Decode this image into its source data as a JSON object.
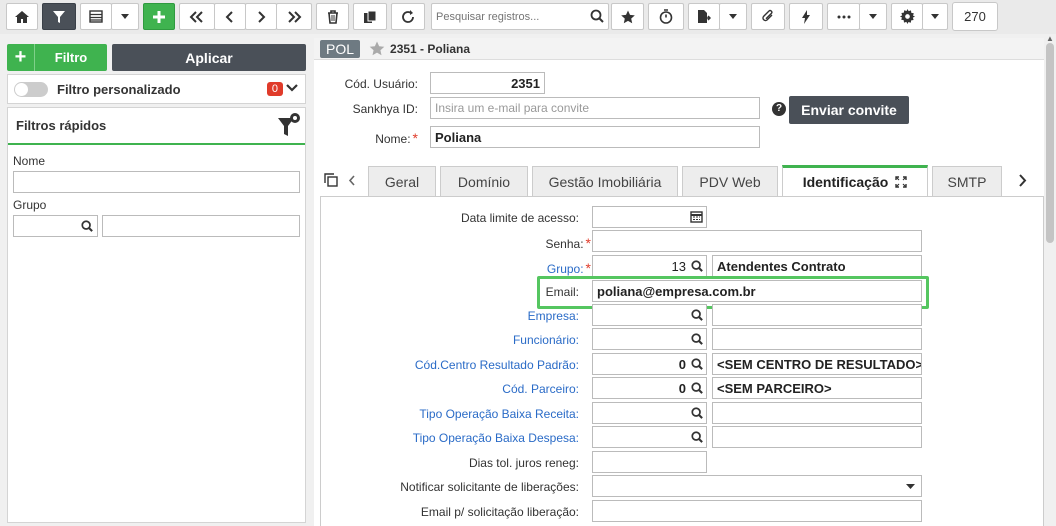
{
  "toolbar": {
    "search_placeholder": "Pesquisar registros...",
    "record_count": "270",
    "icons": [
      "home-icon",
      "filter-icon",
      "grid-icon",
      "chevron-down-icon",
      "plus-icon",
      "first-icon",
      "prev-icon",
      "next-icon",
      "last-icon",
      "trash-icon",
      "copy-icon",
      "refresh-icon",
      "search-icon",
      "star-icon",
      "timer-icon",
      "export-icon",
      "chevron-down-icon",
      "attach-icon",
      "lightning-icon",
      "more-icon",
      "chevron-down-icon",
      "gear-icon",
      "chevron-down-icon"
    ]
  },
  "sidebar": {
    "filtro_label": "Filtro",
    "aplicar_label": "Aplicar",
    "filtro_personalizado": "Filtro personalizado",
    "filtro_count": "0",
    "filtros_rapidos": "Filtros rápidos",
    "nome_label": "Nome",
    "grupo_label": "Grupo"
  },
  "header": {
    "tag": "POL",
    "title": "2351 - Poliana"
  },
  "form": {
    "cod_usuario_label": "Cód. Usuário:",
    "cod_usuario_value": "2351",
    "sankhya_id_label": "Sankhya ID:",
    "sankhya_id_placeholder": "Insira um e-mail para convite",
    "enviar_convite_label": "Enviar convite",
    "nome_label": "Nome:",
    "nome_value": "Poliana"
  },
  "tabs": [
    "Geral",
    "Domínio",
    "Gestão Imobiliária",
    "PDV Web",
    "Identificação",
    "SMTP"
  ],
  "active_tab": "Identificação",
  "fields": {
    "data_limite_label": "Data limite de acesso:",
    "senha_label": "Senha:",
    "grupo_label": "Grupo:",
    "grupo_code": "13",
    "grupo_desc": "Atendentes Contrato",
    "email_label": "Email:",
    "email_value": "poliana@empresa.com.br",
    "empresa_label": "Empresa:",
    "funcionario_label": "Funcionário:",
    "centro_label": "Cód.Centro Resultado Padrão:",
    "centro_code": "0",
    "centro_desc": "<SEM CENTRO DE RESULTADO>",
    "parceiro_label": "Cód. Parceiro:",
    "parceiro_code": "0",
    "parceiro_desc": "<SEM PARCEIRO>",
    "tipo_receita_label": "Tipo Operação Baixa Receita:",
    "tipo_despesa_label": "Tipo Operação Baixa Despesa:",
    "dias_tol_label": "Dias tol. juros reneg:",
    "notificar_label": "Notificar solicitante de liberações:",
    "email_solic_label": "Email p/ solicitação liberação:"
  },
  "colors": {
    "accent": "#3fb34f",
    "dark": "#4a5058",
    "link": "#2a6bc7",
    "required": "#e03b2a"
  }
}
